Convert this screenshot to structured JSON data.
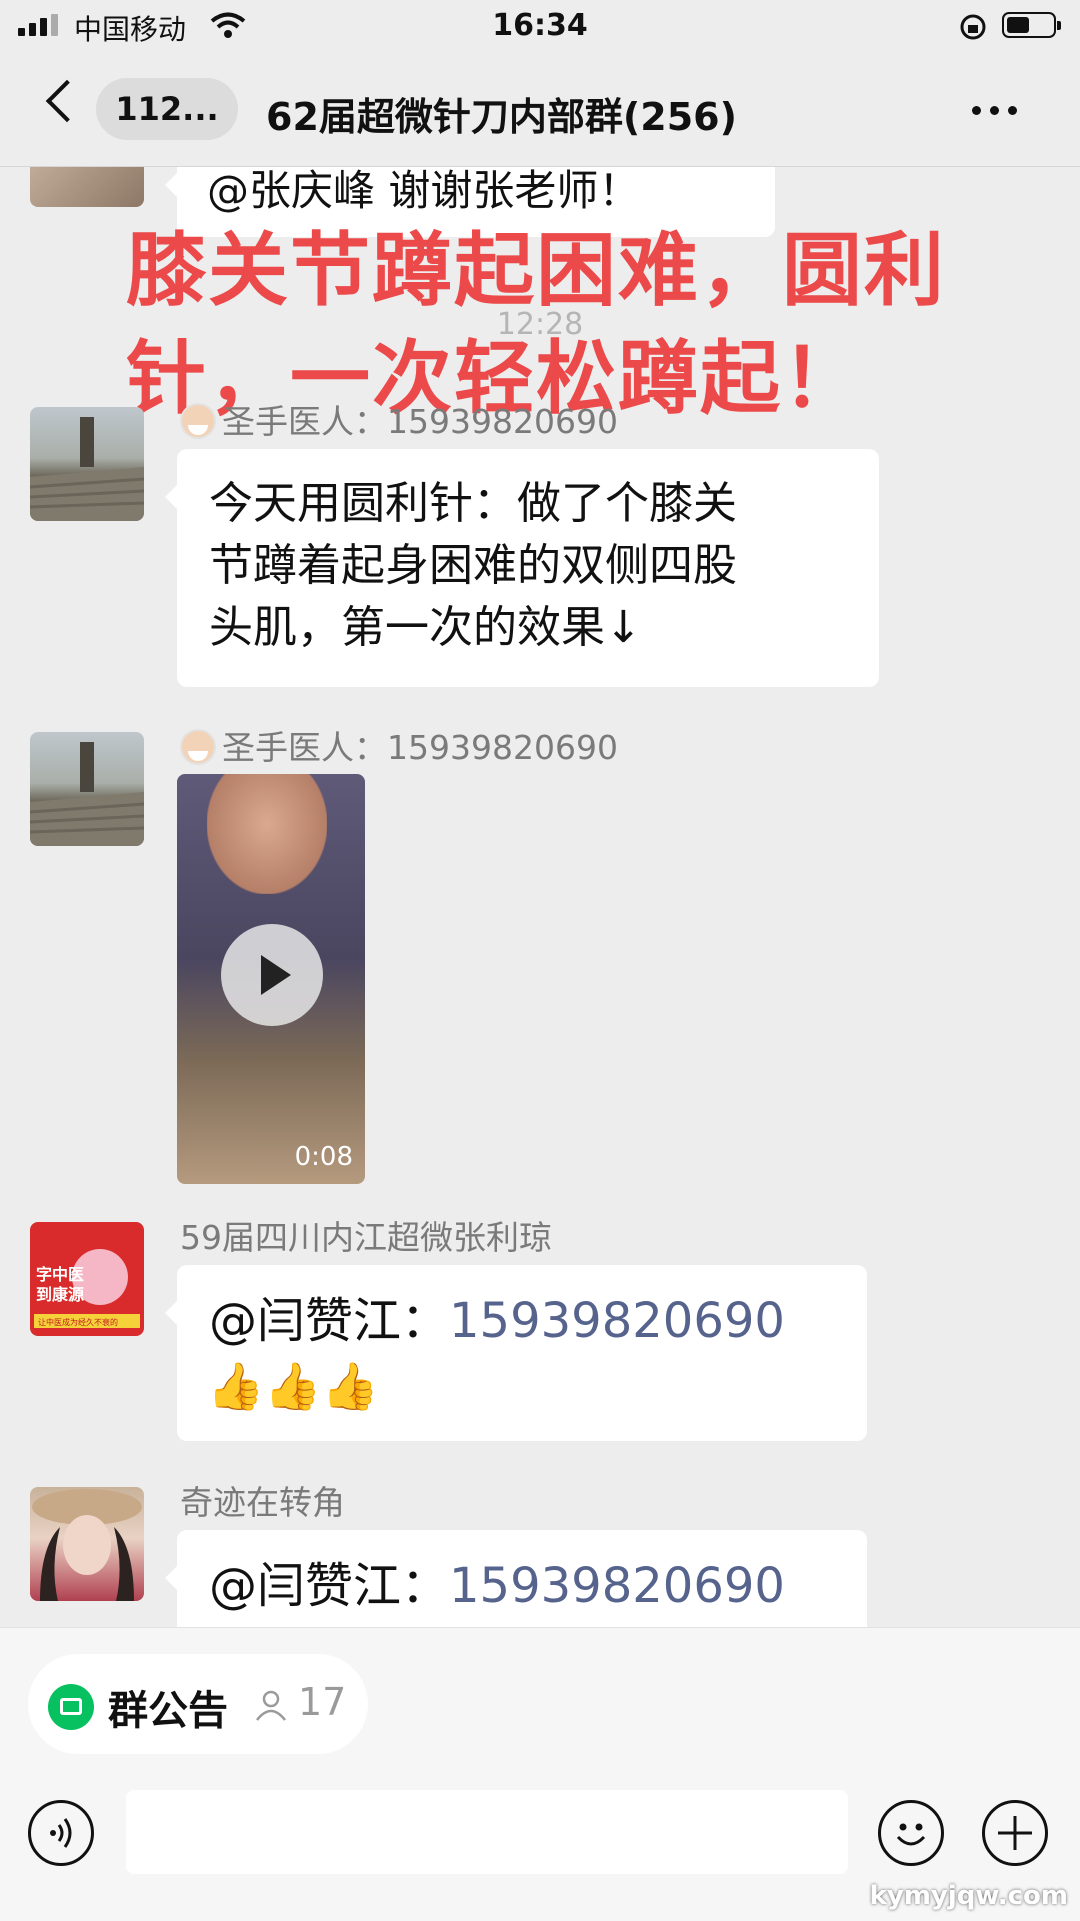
{
  "status_bar": {
    "carrier": "中国移动",
    "time": "16:34"
  },
  "header": {
    "back_count": "112...",
    "title": "62届超微针刀内部群(256)"
  },
  "overlay": {
    "line1": "膝关节蹲起困难，圆利",
    "line2": "针，一次轻松蹲起！"
  },
  "timestamp": "12:28",
  "messages": [
    {
      "sender": "",
      "text": "@张庆峰 谢谢张老师！"
    },
    {
      "sender": "圣手医人：15939820690",
      "text_lines": [
        "今天用圆利针：做了个膝关",
        "节蹲着起身困难的双侧四股",
        "头肌，第一次的效果↓"
      ]
    },
    {
      "sender": "圣手医人：15939820690",
      "video_duration": "0:08"
    },
    {
      "sender": "59届四川内江超微张利琼",
      "mention": "@闫赞江：",
      "phone": "15939820690",
      "thumbs": "👍👍👍"
    },
    {
      "sender": "奇迹在转角",
      "mention": "@闫赞江：",
      "phone": "15939820690"
    }
  ],
  "avatar3_text": {
    "line1": "字中医",
    "line2": "到康源",
    "line3": "让中医成为经久不衰的"
  },
  "bottom": {
    "notice_label": "群公告",
    "notice_count": "17"
  },
  "watermark": "kymyjqw.com",
  "colors": {
    "overlay_red": "#ec4a4a",
    "link_blue": "#56648d",
    "notice_green": "#07c160"
  }
}
